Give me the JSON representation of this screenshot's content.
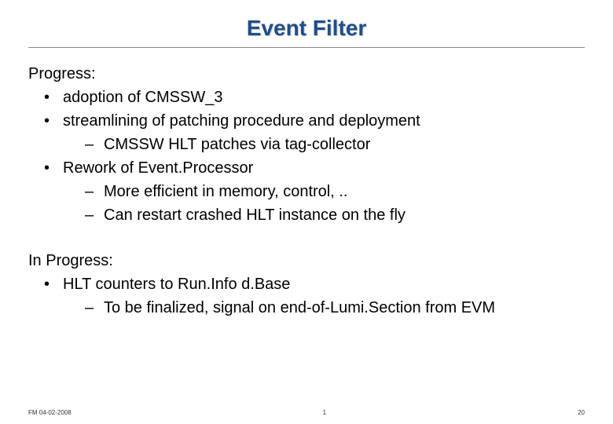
{
  "title": "Event Filter",
  "section1": {
    "label": "Progress:",
    "items": [
      {
        "text": "adoption of CMSSW_3"
      },
      {
        "text": "streamlining of patching procedure and deployment",
        "sub": [
          {
            "text": "CMSSW HLT patches via tag-collector"
          }
        ]
      },
      {
        "text": "Rework of Event.Processor",
        "sub": [
          {
            "text": "More efficient in memory, control, .."
          },
          {
            "text": "Can restart crashed HLT instance on the fly"
          }
        ]
      }
    ]
  },
  "section2": {
    "label": "In Progress:",
    "items": [
      {
        "text": "HLT counters to Run.Info d.Base",
        "sub": [
          {
            "text": "To be finalized, signal on end-of-Lumi.Section from EVM"
          }
        ]
      }
    ]
  },
  "footer": {
    "left": "FM 04-02-2008",
    "center": "1",
    "right": "20"
  }
}
